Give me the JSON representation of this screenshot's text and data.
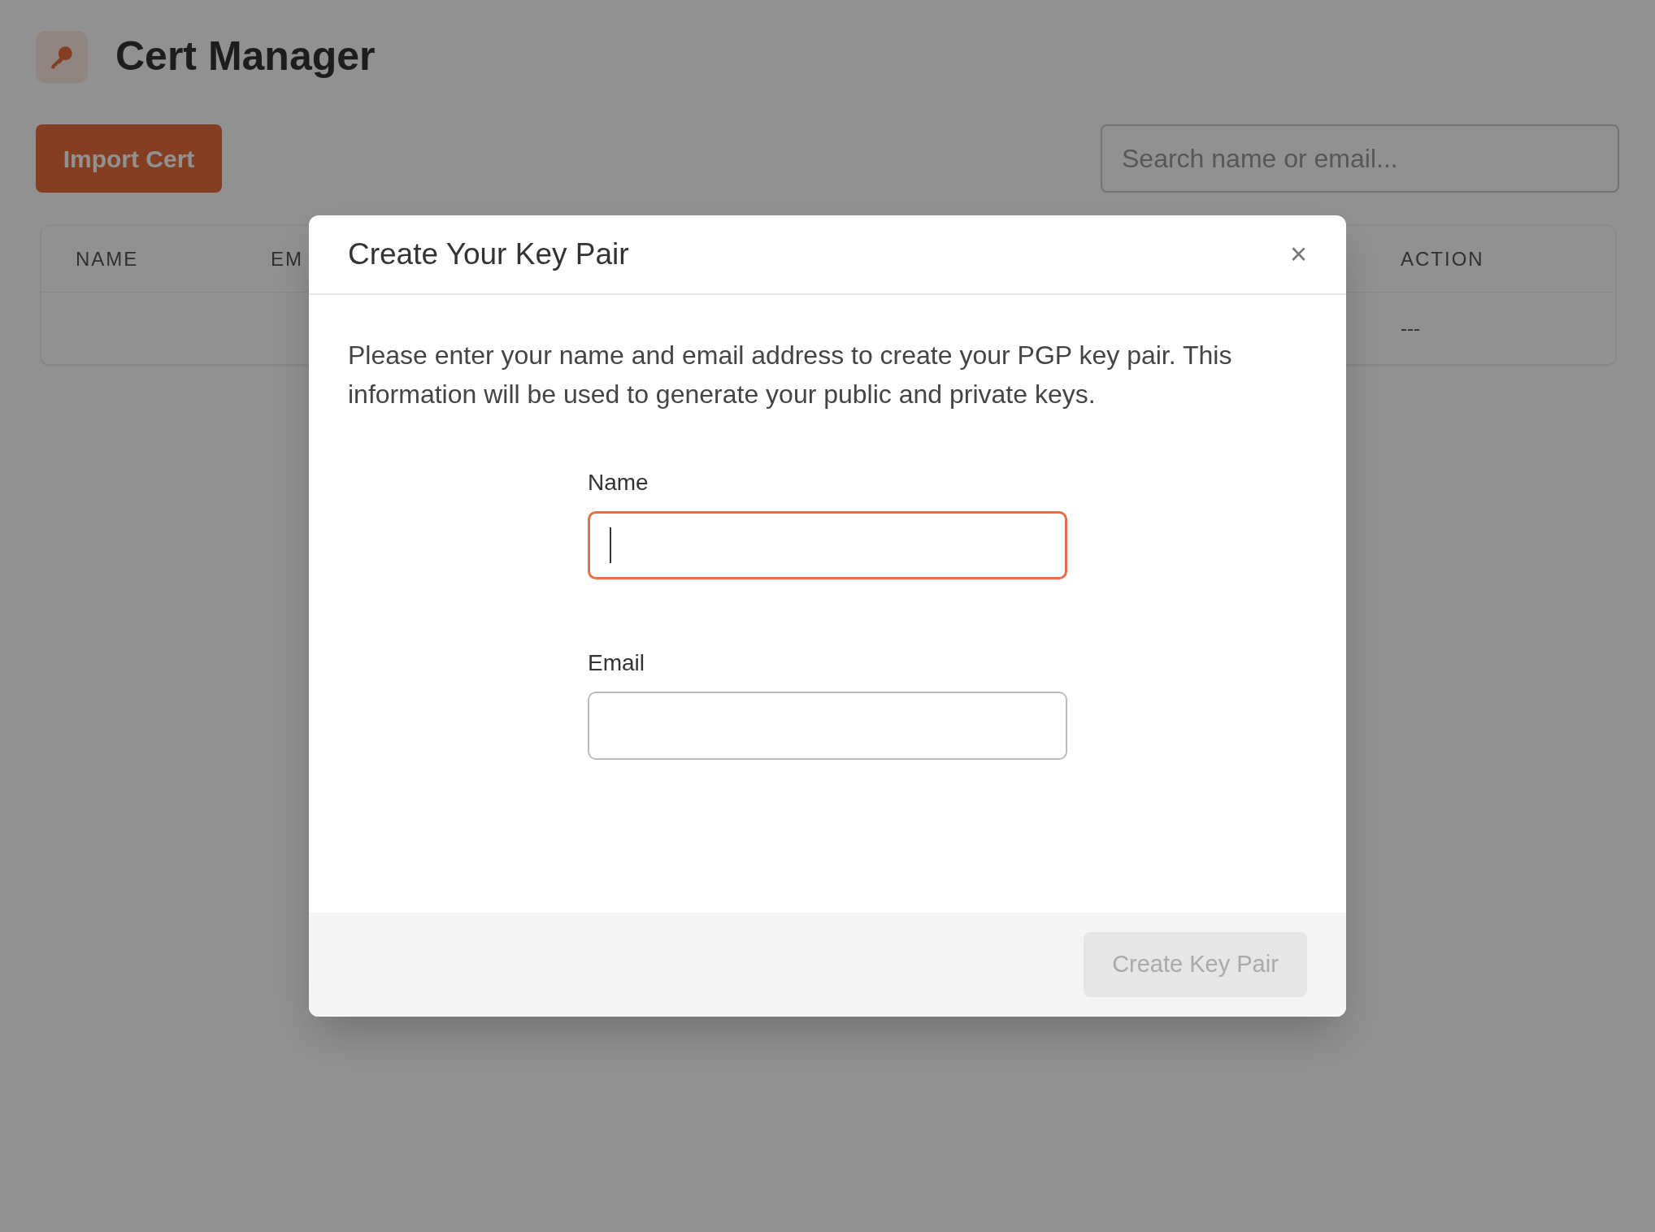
{
  "app": {
    "title": "Cert Manager"
  },
  "toolbar": {
    "import_button": "Import Cert",
    "search": {
      "placeholder": "Search name or email..."
    }
  },
  "table": {
    "columns": [
      "NAME",
      "EM",
      "ACTION"
    ],
    "rows": [
      {
        "action": "---"
      }
    ]
  },
  "dialog": {
    "title": "Create Your Key Pair",
    "close": "×",
    "description": "Please enter your name and email address to create your PGP key pair. This information will be used to generate your public and private keys.",
    "fields": [
      {
        "label": "Name",
        "focused": true
      },
      {
        "label": "Email",
        "focused": false
      }
    ],
    "submit": {
      "label": "Create Key Pair",
      "disabled": true
    }
  }
}
